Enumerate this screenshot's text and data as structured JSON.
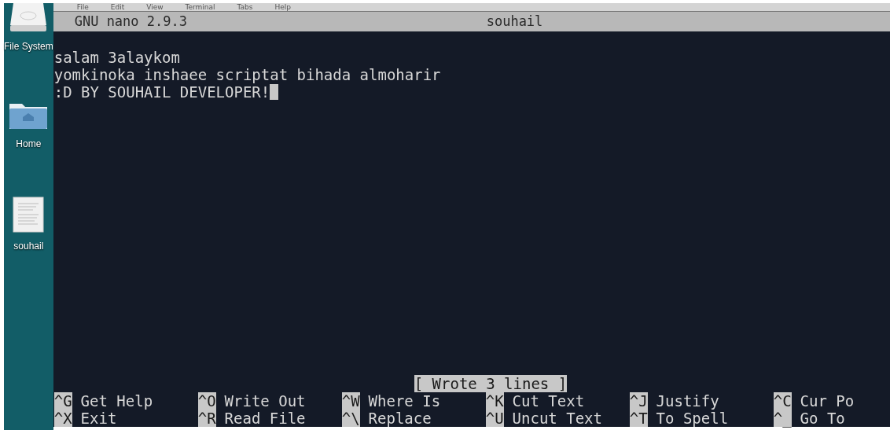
{
  "desktop": {
    "icons": [
      {
        "kind": "drive",
        "label": "File System"
      },
      {
        "kind": "folder",
        "label": "Home"
      },
      {
        "kind": "document",
        "label": "souhail"
      }
    ]
  },
  "terminal": {
    "menu": [
      "File",
      "Edit",
      "View",
      "Terminal",
      "Tabs",
      "Help"
    ],
    "title_bar": {
      "app": "GNU nano 2.9.3",
      "filename": "souhail"
    },
    "lines": [
      {
        "text": "salam 3alaykom",
        "cursor": false
      },
      {
        "text": "yomkinoka inshaee scriptat bihada almoharir",
        "cursor": false
      },
      {
        "text": ":D BY SOUHAIL DEVELOPER!",
        "cursor": true
      }
    ],
    "status": "[ Wrote 3 lines ]",
    "shortcuts": [
      [
        {
          "key": "^G",
          "label": "Get Help"
        },
        {
          "key": "^O",
          "label": "Write Out"
        },
        {
          "key": "^W",
          "label": "Where Is"
        },
        {
          "key": "^K",
          "label": "Cut Text"
        },
        {
          "key": "^J",
          "label": "Justify"
        },
        {
          "key": "^C",
          "label": "Cur Po"
        }
      ],
      [
        {
          "key": "^X",
          "label": "Exit"
        },
        {
          "key": "^R",
          "label": "Read File"
        },
        {
          "key": "^\\",
          "label": "Replace"
        },
        {
          "key": "^U",
          "label": "Uncut Text"
        },
        {
          "key": "^T",
          "label": "To Spell"
        },
        {
          "key": "^_",
          "label": "Go To"
        }
      ]
    ]
  }
}
